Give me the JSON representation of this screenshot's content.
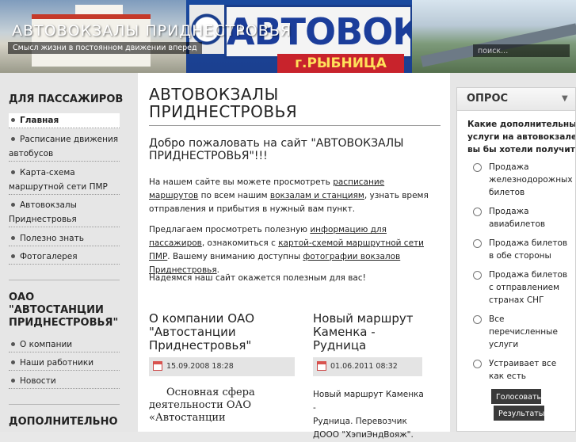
{
  "header": {
    "site_title": "АВТОВОКЗАЛЫ ПРИДНЕСТРОВЬЯ",
    "slogan": "Смысл жизни в постоянном движении вперед",
    "sign_text": "АВТОВОКЗАЛ",
    "sign_city": "г.РЫБНИЦА",
    "search_placeholder": "поиск..."
  },
  "sidebar_left": {
    "section1_title": "ДЛЯ ПАССАЖИРОВ",
    "items1": [
      {
        "label": "Главная",
        "active": true
      },
      {
        "label_line1": "Расписание движения",
        "label_line2": "автобусов"
      },
      {
        "label_line1": "Карта-схема",
        "label_line2": "маршрутной сети ПМР"
      },
      {
        "label_line1": "Автовокзалы",
        "label_line2": "Приднестровья"
      },
      {
        "label": "Полезно знать"
      },
      {
        "label": "Фотогалерея"
      }
    ],
    "section2_title_line1": "ОАО",
    "section2_title_line2": "\"АВТОСТАНЦИИ",
    "section2_title_line3": "ПРИДНЕСТРОВЬЯ\"",
    "items2": [
      "О компании",
      "Наши работники",
      "Новости"
    ],
    "section3_title": "ДОПОЛНИТЕЛЬНО"
  },
  "main": {
    "title_line1": "АВТОВОКЗАЛЫ",
    "title_line2": "ПРИДНЕСТРОВЬЯ",
    "welcome_line1": "Добро пожаловать на сайт \"АВТОВОКЗАЛЫ",
    "welcome_line2": "ПРИДНЕСТРОВЬЯ\"!!!",
    "p1": {
      "t1": "На нашем сайте вы можете просмотреть ",
      "l1": "расписание маршрутов",
      "t2": " по всем нашим ",
      "l2": "вокзалам и станциям",
      "t3": ", узнать время отправления и прибытия в нужный вам пункт."
    },
    "p2": {
      "t1": "Предлагаем  просмотреть полезную ",
      "l1": "информацию для пассажиров",
      "t2": ", ознакомиться с ",
      "l2": "картой-схемой маршрутной сети ПМР",
      "t3": ". Вашему вниманию доступны ",
      "l3": "фотографии вокзалов Приднестровья",
      "t4": "."
    },
    "p3": "Надеямся наш сайт окажется полезным для вас!",
    "article1": {
      "title_line1": "О компании ОАО",
      "title_line2": "\"Автостанции",
      "title_line3": "Приднестровья\"",
      "date": "15.09.2008 18:28",
      "text_line1": "Основная сфера",
      "text_line2": "деятельности ОАО",
      "text_line3": "«Автостанции"
    },
    "article2": {
      "title_line1": "Новый маршрут",
      "title_line2": "Каменка -",
      "title_line3": "Рудница",
      "date": "01.06.2011 08:32",
      "text_line1": "Новый маршрут Каменка -",
      "text_line2": "Рудница. Перевозчик",
      "text_line3": "ДООО \"ХэпиЭндВояж\"."
    }
  },
  "poll": {
    "title": "ОПРОС",
    "question_line1": "Какие дополнительные",
    "question_line2": "услуги на автовокзале",
    "question_line3": "вы бы хотели получить?",
    "options": [
      {
        "l1": "Продажа",
        "l2": "железнодорожных",
        "l3": "билетов"
      },
      {
        "l1": "Продажа",
        "l2": "авиабилетов"
      },
      {
        "l1": "Продажа билетов",
        "l2": "в обе стороны"
      },
      {
        "l1": "Продажа билетов",
        "l2": "с отправлением",
        "l3": "странах СНГ"
      },
      {
        "l1": "Все",
        "l2": "перечисленные",
        "l3": "услуги"
      },
      {
        "l1": "Устраивает все",
        "l2": "как есть"
      }
    ],
    "vote_label": "Голосовать",
    "results_label": "Результаты"
  }
}
